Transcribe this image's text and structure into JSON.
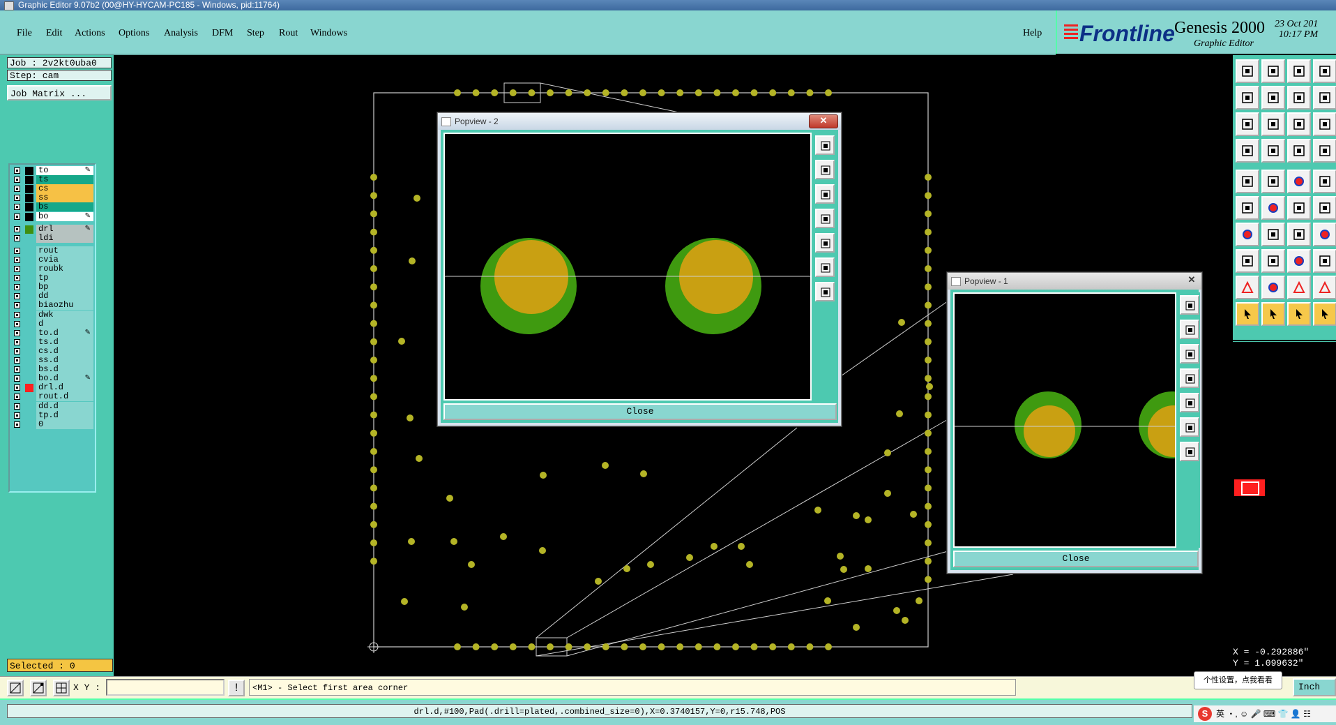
{
  "window": {
    "title": "Graphic Editor 9.07b2 (00@HY-HYCAM-PC185 - Windows, pid:11764)"
  },
  "menubar": {
    "items": [
      "File",
      "Edit",
      "Actions",
      "Options",
      "Analysis",
      "DFM",
      "Step",
      "Rout",
      "Windows"
    ],
    "help": "Help"
  },
  "brand": {
    "logo": "Frontline",
    "product": "Genesis 2000",
    "subtitle": "Graphic Editor",
    "date": "23 Oct 201",
    "time": "10:17 PM"
  },
  "job": {
    "job_label": "Job : 2v2kt0uba0",
    "step_label": "Step: cam",
    "matrix_button": "Job Matrix ..."
  },
  "layers": [
    {
      "name": "to",
      "color": "#ffffff",
      "swatch": "#000000",
      "affected": true
    },
    {
      "name": "ts",
      "color": "#16a88a",
      "swatch": "#000000",
      "affected": false
    },
    {
      "name": "cs",
      "color": "#f6c145",
      "swatch": "#000000",
      "affected": false
    },
    {
      "name": "ss",
      "color": "#f6c145",
      "swatch": "#000000",
      "affected": false
    },
    {
      "name": "bs",
      "color": "#16a88a",
      "swatch": "#000000",
      "affected": false
    },
    {
      "name": "bo",
      "color": "#ffffff",
      "swatch": "#000000",
      "affected": true
    },
    {
      "name": "drl",
      "color": "#b6c2c0",
      "swatch": "#3f8f10",
      "affected": true
    },
    {
      "name": "ldi",
      "color": "#b6c2c0",
      "swatch": "#56c8c0",
      "affected": false
    },
    {
      "name": "rout",
      "color": "#89d6d0",
      "swatch": "#56c8c0",
      "affected": false
    },
    {
      "name": "cvia",
      "color": "#89d6d0",
      "swatch": "#56c8c0",
      "affected": false
    },
    {
      "name": "roubk",
      "color": "#89d6d0",
      "swatch": "#56c8c0",
      "affected": false
    },
    {
      "name": "tp",
      "color": "#89d6d0",
      "swatch": "#56c8c0",
      "affected": false
    },
    {
      "name": "bp",
      "color": "#89d6d0",
      "swatch": "#56c8c0",
      "affected": false
    },
    {
      "name": "dd",
      "color": "#89d6d0",
      "swatch": "#56c8c0",
      "affected": false
    },
    {
      "name": "biaozhu",
      "color": "#89d6d0",
      "swatch": "#56c8c0",
      "affected": false
    },
    {
      "name": "dwk",
      "color": "#89d6d0",
      "swatch": "#56c8c0",
      "affected": false
    },
    {
      "name": "d",
      "color": "#89d6d0",
      "swatch": "#56c8c0",
      "affected": false
    },
    {
      "name": "to.d",
      "color": "#89d6d0",
      "swatch": "#56c8c0",
      "affected": true
    },
    {
      "name": "ts.d",
      "color": "#89d6d0",
      "swatch": "#56c8c0",
      "affected": false
    },
    {
      "name": "cs.d",
      "color": "#89d6d0",
      "swatch": "#56c8c0",
      "affected": false
    },
    {
      "name": "ss.d",
      "color": "#89d6d0",
      "swatch": "#56c8c0",
      "affected": false
    },
    {
      "name": "bs.d",
      "color": "#89d6d0",
      "swatch": "#56c8c0",
      "affected": false
    },
    {
      "name": "bo.d",
      "color": "#89d6d0",
      "swatch": "#56c8c0",
      "affected": true
    },
    {
      "name": "drl.d",
      "color": "#89d6d0",
      "swatch": "#ff1f1f",
      "affected": false
    },
    {
      "name": "rout.d",
      "color": "#89d6d0",
      "swatch": "#56c8c0",
      "affected": false
    },
    {
      "name": "dd.d",
      "color": "#89d6d0",
      "swatch": "#56c8c0",
      "affected": false
    },
    {
      "name": "tp.d",
      "color": "#89d6d0",
      "swatch": "#56c8c0",
      "affected": false
    },
    {
      "name": "0",
      "color": "#89d6d0",
      "swatch": "#56c8c0",
      "affected": false
    }
  ],
  "selected": {
    "label": "Selected : 0"
  },
  "popview2": {
    "title": "Popview - 2",
    "close_label": "Close",
    "x_glyph": "✕"
  },
  "popview1": {
    "title": "Popview - 1",
    "close_label": "Close",
    "x_glyph": "✕"
  },
  "coords": {
    "x": "X = -0.292886\"",
    "y": "Y =  1.099632\""
  },
  "command": {
    "xy_label": "X Y :",
    "xy_value": "",
    "bang": "!",
    "prompt": "<M1> - Select first area corner",
    "unit": "Inch"
  },
  "status": {
    "text": "drl.d,#100,Pad(.drill=plated,.combined_size=0),X=0.3740157,Y=0,r15.748,POS"
  },
  "tooltip": {
    "text": "个性设置，点我看看"
  },
  "ime": {
    "logo": "S",
    "text": "英 ・, ☺ 🎤 ⌨ 👕 👤 ☷"
  },
  "colors": {
    "pad": "#b4b426",
    "pad_outline": "#9a9a1e",
    "green_pad": "#3f9a10",
    "gold_pad": "#c9a012",
    "board": "#000000",
    "panel": "#4dc9b0"
  },
  "toolbar_icons": [
    "open-step-icon",
    "save-icon",
    "home-icon",
    "window-icon",
    "zoom-prev-icon",
    "zoom-next-icon",
    "io-icon",
    "s-icon",
    "fit-icon",
    "pan-icon",
    "scale-icon",
    "help-icon",
    "layers-icon",
    "measure-icon",
    "snap-icon",
    "grid-icon",
    "pad-icon",
    "line-icon",
    "ruler-icon",
    "dot-icon",
    "net-icon",
    "cross-icon",
    "arc-icon",
    "fit-red-icon",
    "draw-line-icon",
    "slash-icon",
    "curve-icon",
    "edge-icon",
    "gear-icon",
    "minus-icon",
    "box-icon",
    "copy-icon",
    "triangle-icon",
    "tri-a-icon",
    "tri-b-icon",
    "tri-c-icon",
    "pointer-icon",
    "pointer-a-icon",
    "pointer-b-icon",
    "pointer-c-icon"
  ]
}
